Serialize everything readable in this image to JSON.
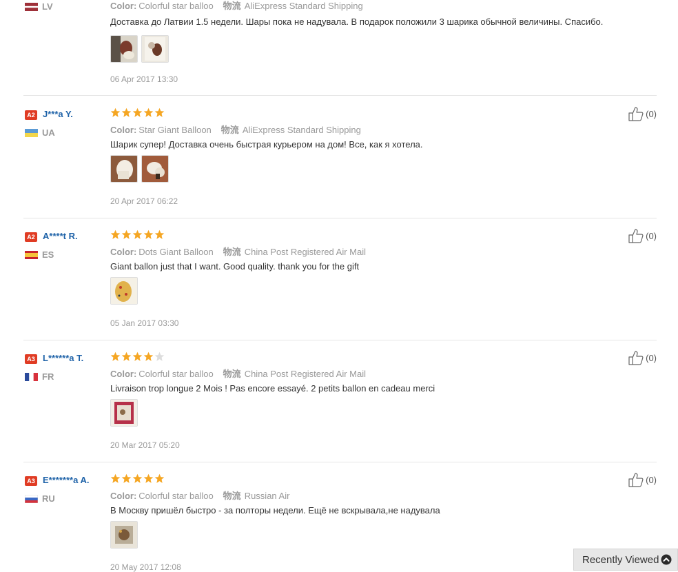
{
  "labels": {
    "color": "Color:",
    "shipping": "物流"
  },
  "reviews": [
    {
      "country": "LV",
      "color": "Colorful star balloo",
      "shipping": "AliExpress Standard Shipping",
      "text": "Доставка до Латвии 1.5 недели. Шары пока не надувала. В подарок положили 3 шарика обычной величины. Спасибо.",
      "date": "06 Apr 2017 13:30",
      "photos": 2
    },
    {
      "level": "A2",
      "name": "J***a Y.",
      "country": "UA",
      "rating": 5,
      "color": "Star Giant Balloon",
      "shipping": "AliExpress Standard Shipping",
      "text": "Шарик супер! Доставка очень быстрая курьером на дом! Все, как я хотела.",
      "date": "20 Apr 2017 06:22",
      "helpful": "(0)",
      "photos": 2
    },
    {
      "level": "A2",
      "name": "A****t R.",
      "country": "ES",
      "rating": 5,
      "color": "Dots Giant Balloon",
      "shipping": "China Post Registered Air Mail",
      "text": "Giant ballon just that I want. Good quality. thank you for the gift",
      "date": "05 Jan 2017 03:30",
      "helpful": "(0)",
      "photos": 1
    },
    {
      "level": "A3",
      "name": "L******a T.",
      "country": "FR",
      "rating": 4,
      "color": "Colorful star balloo",
      "shipping": "China Post Registered Air Mail",
      "text": "Livraison trop longue 2 Mois ! Pas encore essayé. 2 petits ballon en cadeau merci",
      "date": "20 Mar 2017 05:20",
      "helpful": "(0)",
      "photos": 1
    },
    {
      "level": "A3",
      "name": "E*******a A.",
      "country": "RU",
      "rating": 5,
      "color": "Colorful star balloo",
      "shipping": "Russian Air",
      "text": "В Москву пришёл быстро - за полторы недели. Ещё не вскрывала,не надувала",
      "date": "20 May 2017 12:08",
      "helpful": "(0)",
      "photos": 1
    }
  ],
  "recently_viewed": {
    "label": "Recently Viewed"
  },
  "colors": {
    "star": "#f5a623",
    "star_empty": "#dddddd",
    "name": "#1e62a8",
    "badge": "#e03c24"
  },
  "icons": {
    "helpful": "thumbs-up-icon",
    "recent": "chevron-up-icon",
    "star": "star-icon"
  }
}
